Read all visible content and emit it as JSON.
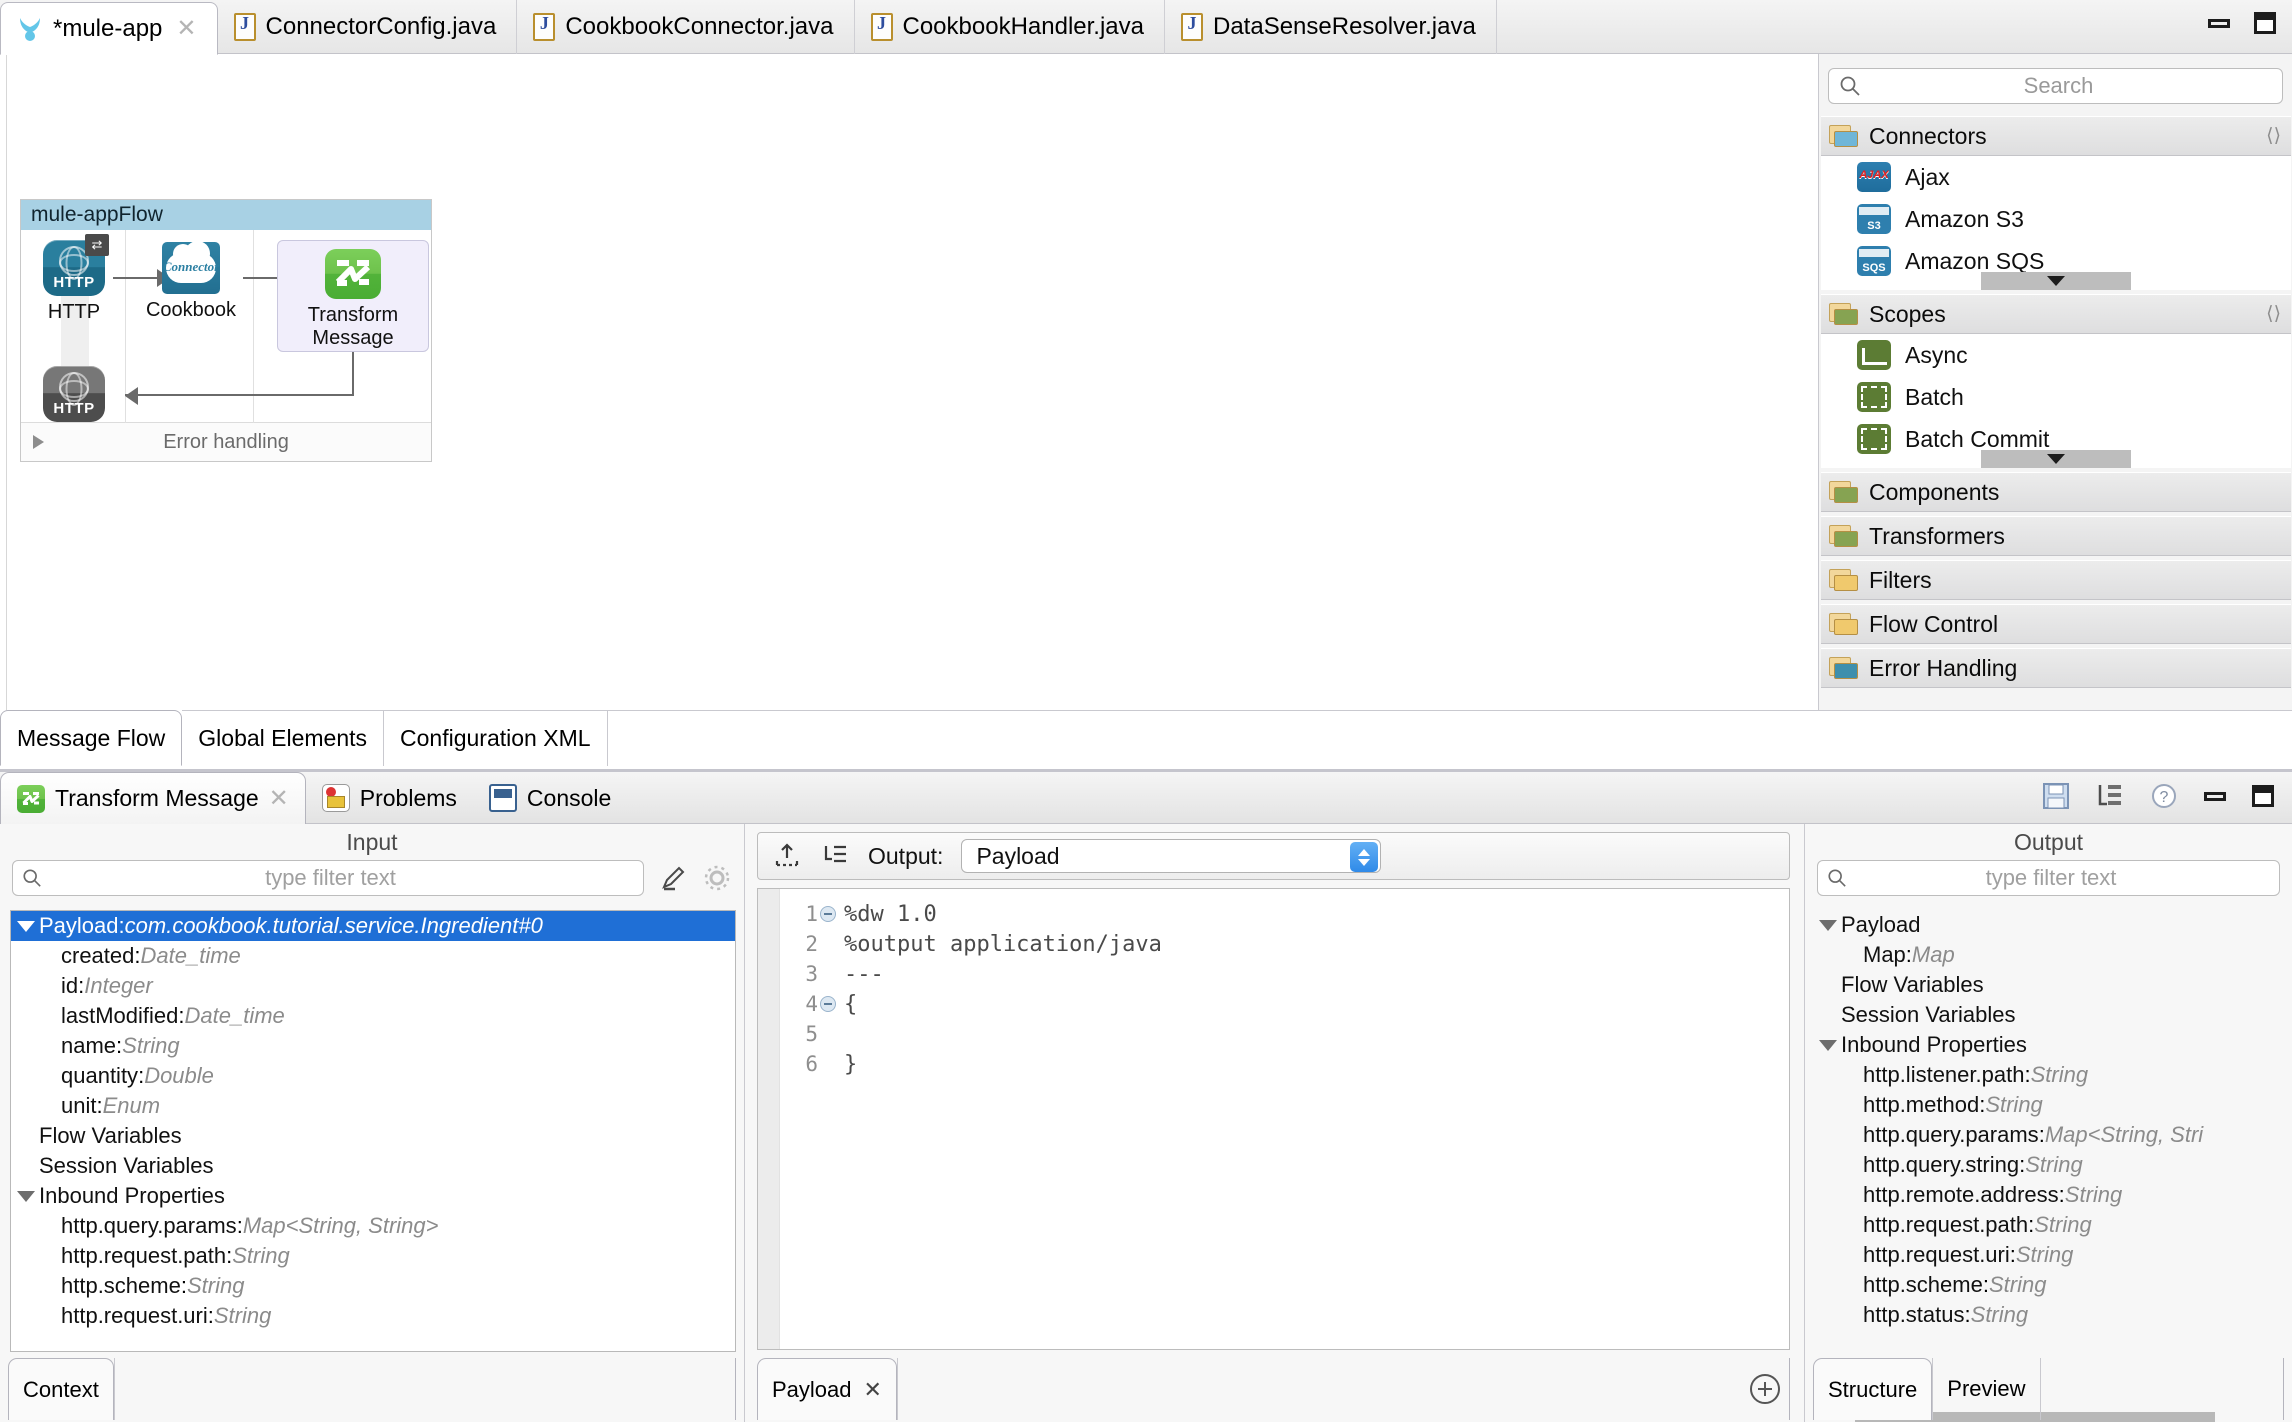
{
  "window": {
    "minimize_label": "minimize",
    "maximize_label": "maximize"
  },
  "editor_tabs": [
    {
      "label": "*mule-app",
      "icon": "mule-icon",
      "active": true,
      "closeable": true
    },
    {
      "label": "ConnectorConfig.java",
      "icon": "java-file-icon",
      "active": false,
      "closeable": false
    },
    {
      "label": "CookbookConnector.java",
      "icon": "java-file-icon",
      "active": false,
      "closeable": false
    },
    {
      "label": "CookbookHandler.java",
      "icon": "java-file-icon",
      "active": false,
      "closeable": false
    },
    {
      "label": "DataSenseResolver.java",
      "icon": "java-file-icon",
      "active": false,
      "closeable": false
    }
  ],
  "flow": {
    "name": "mule-appFlow",
    "error_handling_label": "Error handling",
    "nodes": [
      {
        "id": "http-listener",
        "label": "HTTP",
        "icon": "http-icon"
      },
      {
        "id": "cookbook",
        "label": "Cookbook",
        "icon": "cookbook-connector-icon"
      },
      {
        "id": "transform-message",
        "label": "Transform\nMessage",
        "label_line1": "Transform",
        "label_line2": "Message",
        "icon": "transform-message-icon"
      },
      {
        "id": "http-response",
        "label": "",
        "icon": "http-response-icon"
      }
    ]
  },
  "palette": {
    "search_placeholder": "Search",
    "groups": [
      {
        "name": "Connectors",
        "icon": "folder-blue-icon",
        "expanded": true,
        "has_scroll": true,
        "items": [
          {
            "label": "Ajax",
            "icon": "ajax-icon"
          },
          {
            "label": "Amazon S3",
            "icon": "amazon-s3-icon"
          },
          {
            "label": "Amazon SQS",
            "icon": "amazon-sqs-icon"
          }
        ]
      },
      {
        "name": "Scopes",
        "icon": "folder-green-icon",
        "expanded": true,
        "has_scroll": true,
        "items": [
          {
            "label": "Async",
            "icon": "async-icon"
          },
          {
            "label": "Batch",
            "icon": "batch-icon"
          },
          {
            "label": "Batch Commit",
            "icon": "batch-commit-icon"
          }
        ]
      },
      {
        "name": "Components",
        "icon": "folder-green-icon",
        "expanded": false,
        "items": []
      },
      {
        "name": "Transformers",
        "icon": "folder-green-icon",
        "expanded": false,
        "items": []
      },
      {
        "name": "Filters",
        "icon": "folder-yellow-icon",
        "expanded": false,
        "items": []
      },
      {
        "name": "Flow Control",
        "icon": "folder-yellow-icon",
        "expanded": false,
        "items": []
      },
      {
        "name": "Error Handling",
        "icon": "folder-teal-icon",
        "expanded": false,
        "items": []
      }
    ]
  },
  "editor_view_tabs": [
    {
      "label": "Message Flow",
      "active": true
    },
    {
      "label": "Global Elements",
      "active": false
    },
    {
      "label": "Configuration XML",
      "active": false
    }
  ],
  "bottom_view_tabs": [
    {
      "label": "Transform Message",
      "icon": "transform-message-icon",
      "active": true,
      "closeable": true
    },
    {
      "label": "Problems",
      "icon": "problems-icon",
      "active": false,
      "closeable": false
    },
    {
      "label": "Console",
      "icon": "console-icon",
      "active": false,
      "closeable": false
    }
  ],
  "bottom_toolbar": [
    {
      "name": "save-icon"
    },
    {
      "name": "outline-tree-icon"
    },
    {
      "name": "help-icon"
    },
    {
      "name": "minimize-icon"
    },
    {
      "name": "maximize-icon"
    }
  ],
  "input_panel": {
    "title": "Input",
    "filter_placeholder": "type filter text",
    "edit_icon": "pencil-icon",
    "settings_icon": "gear-icon",
    "tree": [
      {
        "indent": 1,
        "caret": true,
        "name": "Payload",
        "type": "com.cookbook.tutorial.service.Ingredient#0",
        "selected": true
      },
      {
        "indent": 2,
        "caret": false,
        "name": "created",
        "type": "Date_time"
      },
      {
        "indent": 2,
        "caret": false,
        "name": "id",
        "type": "Integer"
      },
      {
        "indent": 2,
        "caret": false,
        "name": "lastModified",
        "type": "Date_time"
      },
      {
        "indent": 2,
        "caret": false,
        "name": "name",
        "type": "String"
      },
      {
        "indent": 2,
        "caret": false,
        "name": "quantity",
        "type": "Double"
      },
      {
        "indent": 2,
        "caret": false,
        "name": "unit",
        "type": "Enum"
      },
      {
        "indent": 1,
        "caret": false,
        "name": "Flow Variables",
        "type": ""
      },
      {
        "indent": 1,
        "caret": false,
        "name": "Session Variables",
        "type": ""
      },
      {
        "indent": 1,
        "caret": true,
        "name": "Inbound Properties",
        "type": ""
      },
      {
        "indent": 2,
        "caret": false,
        "name": "http.query.params",
        "type": "Map<String, String>"
      },
      {
        "indent": 2,
        "caret": false,
        "name": "http.request.path",
        "type": "String"
      },
      {
        "indent": 2,
        "caret": false,
        "name": "http.scheme",
        "type": "String"
      },
      {
        "indent": 2,
        "caret": false,
        "name": "http.request.uri",
        "type": "String"
      }
    ],
    "tabs": [
      {
        "label": "Context",
        "active": true
      }
    ]
  },
  "editor_panel": {
    "import_icon": "import-icon",
    "map_icon": "map-structure-icon",
    "output_label": "Output:",
    "output_value": "Payload",
    "code_lines": [
      {
        "num": "1",
        "fold": true,
        "text": "%dw 1.0"
      },
      {
        "num": "2",
        "fold": false,
        "text": "%output application/java"
      },
      {
        "num": "3",
        "fold": false,
        "text": "---"
      },
      {
        "num": "4",
        "fold": true,
        "text": "{"
      },
      {
        "num": "5",
        "fold": false,
        "text": ""
      },
      {
        "num": "6",
        "fold": false,
        "text": "}"
      }
    ],
    "tabs": [
      {
        "label": "Payload",
        "active": true,
        "closeable": true
      }
    ],
    "add_icon": "plus-circle-icon"
  },
  "output_panel": {
    "title": "Output",
    "filter_placeholder": "type filter text",
    "tree": [
      {
        "indent": 1,
        "caret": true,
        "name": "Payload",
        "type": ""
      },
      {
        "indent": 2,
        "caret": false,
        "name": "Map",
        "type": "Map"
      },
      {
        "indent": 1,
        "caret": false,
        "name": "Flow Variables",
        "type": ""
      },
      {
        "indent": 1,
        "caret": false,
        "name": "Session Variables",
        "type": ""
      },
      {
        "indent": 1,
        "caret": true,
        "name": "Inbound Properties",
        "type": ""
      },
      {
        "indent": 2,
        "caret": false,
        "name": "http.listener.path",
        "type": "String"
      },
      {
        "indent": 2,
        "caret": false,
        "name": "http.method",
        "type": "String"
      },
      {
        "indent": 2,
        "caret": false,
        "name": "http.query.params",
        "type": "Map<String, Stri"
      },
      {
        "indent": 2,
        "caret": false,
        "name": "http.query.string",
        "type": "String"
      },
      {
        "indent": 2,
        "caret": false,
        "name": "http.remote.address",
        "type": "String"
      },
      {
        "indent": 2,
        "caret": false,
        "name": "http.request.path",
        "type": "String"
      },
      {
        "indent": 2,
        "caret": false,
        "name": "http.request.uri",
        "type": "String"
      },
      {
        "indent": 2,
        "caret": false,
        "name": "http.scheme",
        "type": "String"
      },
      {
        "indent": 2,
        "caret": false,
        "name": "http.status",
        "type": "String"
      }
    ],
    "tabs": [
      {
        "label": "Structure",
        "active": true
      },
      {
        "label": "Preview",
        "active": false
      }
    ]
  },
  "colors": {
    "flow_header": "#a8d1e4",
    "selection": "#1f6fd6",
    "transform_green": "#6ec24c",
    "http_blue": "#2a7f9e"
  }
}
